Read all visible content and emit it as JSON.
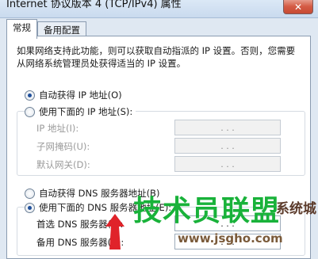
{
  "window": {
    "title": "Internet 协议版本 4 (TCP/IPv4) 属性",
    "close_glyph": "✕"
  },
  "tabs": [
    {
      "label": "常规",
      "active": true
    },
    {
      "label": "备用配置",
      "active": false
    }
  ],
  "intro": "如果网络支持此功能，则可以获取自动指派的 IP 设置。否则，您需要从网络系统管理员处获得适当的 IP 设置。",
  "ip_section": {
    "auto_label": "自动获得 IP 地址(O)",
    "manual_label": "使用下面的 IP 地址(S):",
    "selected": "auto",
    "fields": [
      {
        "label": "IP 地址(I):",
        "value": ". . ."
      },
      {
        "label": "子网掩码(U):",
        "value": ". . ."
      },
      {
        "label": "默认网关(D):",
        "value": ". . ."
      }
    ]
  },
  "dns_section": {
    "auto_label": "自动获得 DNS 服务器地址(B)",
    "manual_label": "使用下面的 DNS 服务器地址(E):",
    "selected": "manual",
    "fields": [
      {
        "label": "首选 DNS 服务器(P):",
        "value": ". . ."
      },
      {
        "label": "备用 DNS 服务器(A):",
        "value": ". . ."
      }
    ]
  },
  "watermark": {
    "main": "技术员联盟",
    "sub": "系统城",
    "url": "www.jsgho.com"
  },
  "colors": {
    "accent": "#1f4f9a",
    "watermark_green": "#19b23a",
    "annotation_arrow": "#e0232a"
  }
}
